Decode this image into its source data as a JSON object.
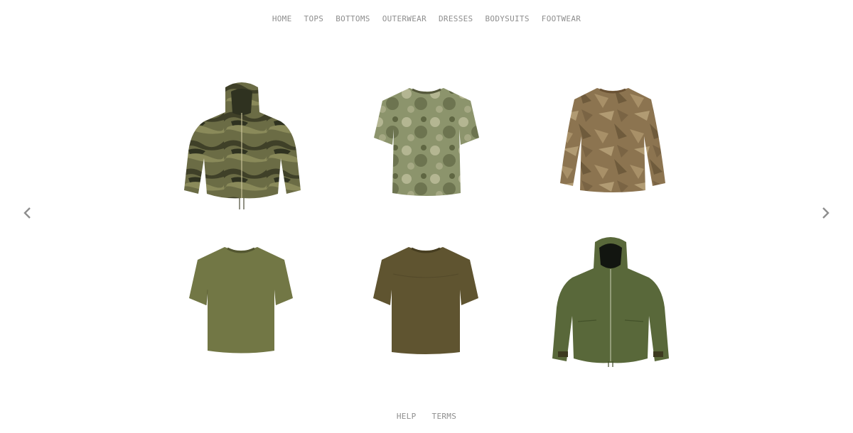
{
  "nav": {
    "items": [
      {
        "label": "HOME"
      },
      {
        "label": "TOPS"
      },
      {
        "label": "BOTTOMS"
      },
      {
        "label": "OUTERWEAR"
      },
      {
        "label": "DRESSES"
      },
      {
        "label": "BODYSUITS"
      },
      {
        "label": "FOOTWEAR"
      }
    ]
  },
  "carousel": {
    "prev_icon": "chevron-left-icon",
    "next_icon": "chevron-right-icon",
    "arrow_color": "#8e8e8e"
  },
  "products": [
    {
      "kind": "camo-hooded-jacket",
      "color": "#5b5f3a"
    },
    {
      "kind": "camo-tshirt",
      "color": "#8c946c"
    },
    {
      "kind": "camo-longsleeve",
      "color": "#8c7450"
    },
    {
      "kind": "olive-tshirt",
      "color": "#727745"
    },
    {
      "kind": "brown-tshirt",
      "color": "#5f5430"
    },
    {
      "kind": "olive-hooded-jacket",
      "color": "#59683a"
    }
  ],
  "footer": {
    "help_label": "HELP",
    "terms_label": "TERMS"
  }
}
